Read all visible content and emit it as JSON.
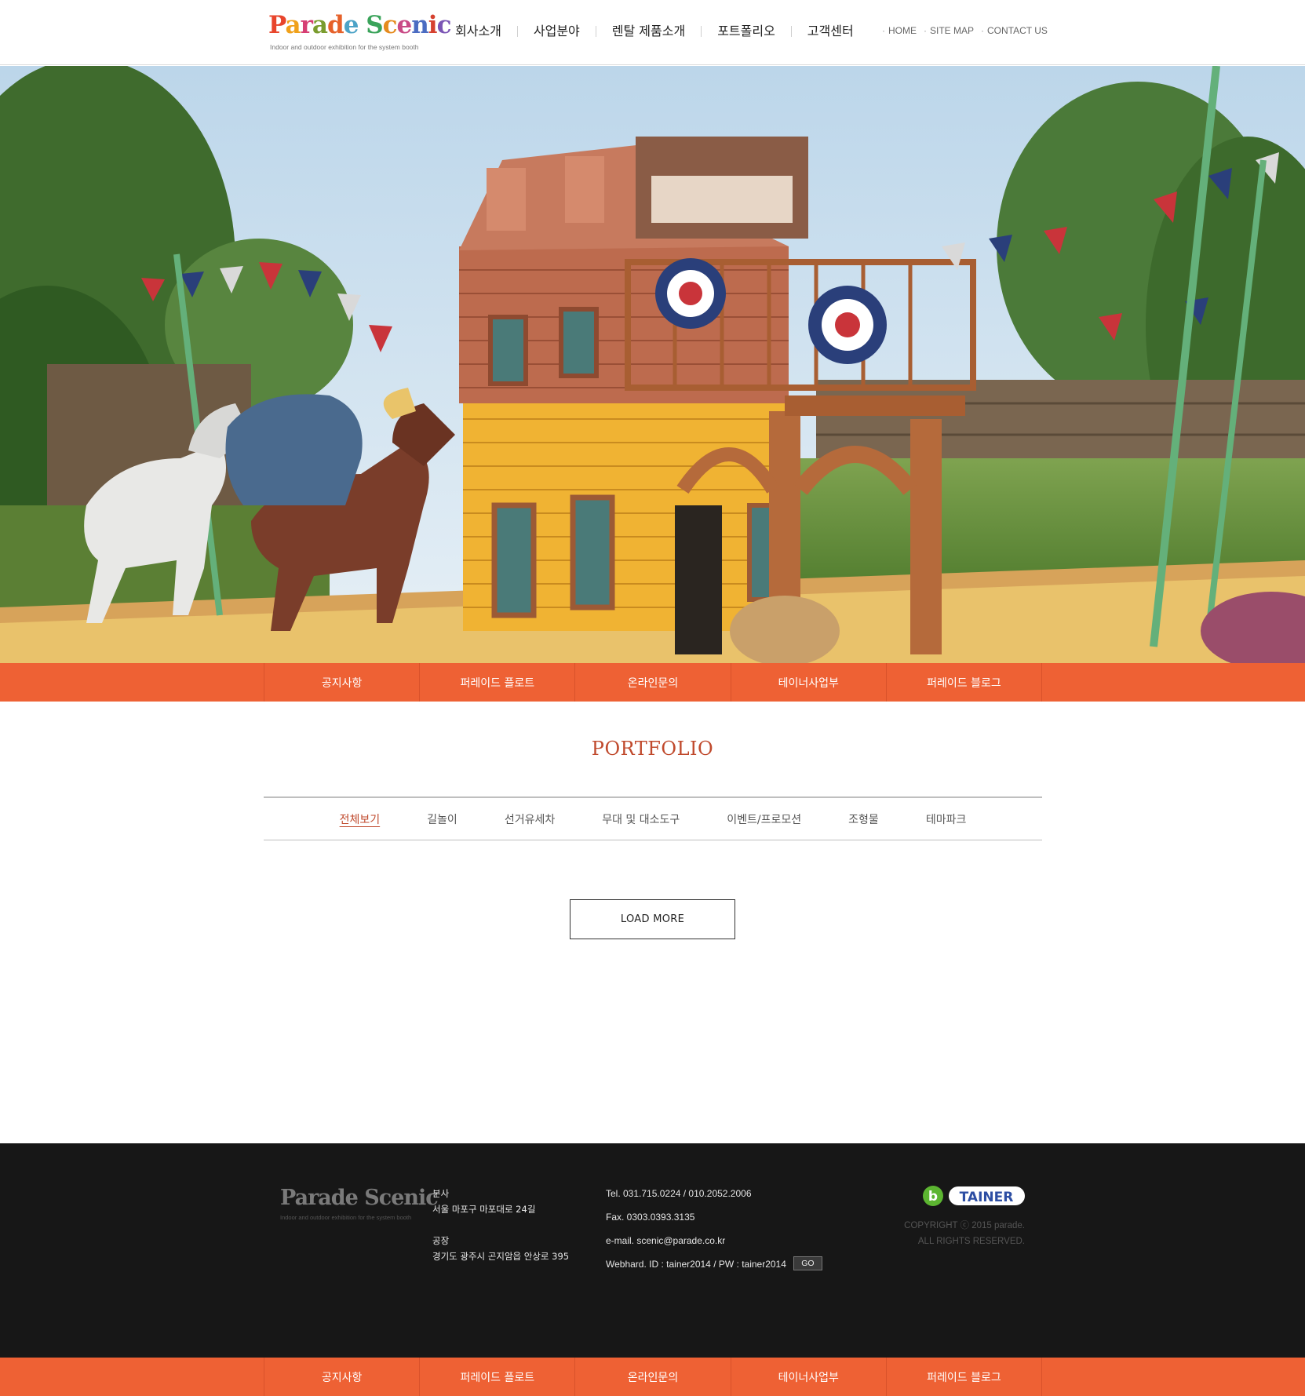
{
  "header": {
    "logo": {
      "brand": "Parade Scenic",
      "tagline": "Indoor and outdoor exhibition for the system booth",
      "icon": "parade-scenic-logo"
    },
    "nav": [
      "회사소개",
      "사업분야",
      "렌탈 제품소개",
      "포트폴리오",
      "고객센터"
    ],
    "util": [
      "HOME",
      "SITE MAP",
      "CONTACT US"
    ]
  },
  "hero": {
    "slide_count": 3,
    "active_slide": 1
  },
  "quick_links": [
    "공지사항",
    "퍼레이드 플로트",
    "온라인문의",
    "테이너사업부",
    "퍼레이드 블로그"
  ],
  "portfolio": {
    "title": "PORTFOLIO",
    "filters": [
      "전체보기",
      "길놀이",
      "선거유세차",
      "무대 및 대소도구",
      "이벤트/프로모션",
      "조형물",
      "테마파크"
    ],
    "active_filter": "전체보기",
    "load_more_label": "LOAD MORE"
  },
  "footer": {
    "logo": {
      "brand": "Parade Scenic",
      "tagline": "Indoor and outdoor exhibition for the system booth"
    },
    "hq_label": "본사",
    "hq_address": "서울 마포구 마포대로 24길",
    "factory_label": "공장",
    "factory_address": "경기도 광주시 곤지암읍 안상로 395",
    "tel": "Tel. 031.715.0224 / 010.2052.2006",
    "fax": "Fax. 0303.0393.3135",
    "email": "e-mail. scenic@parade.co.kr",
    "webhard": "Webhard. ID : tainer2014 / PW : tainer2014",
    "go_label": "GO",
    "brand_badge": "TAINER",
    "blog_icon_letter": "b",
    "copyright_line1": "COPYRIGHT ⓒ 2015 parade.",
    "copyright_line2": "ALL RIGHTS RESERVED."
  },
  "colors": {
    "accent_orange": "#ee6134",
    "title_red": "#c04a2d",
    "footer_bg": "#171717",
    "slider_active": "#e83a1f"
  }
}
